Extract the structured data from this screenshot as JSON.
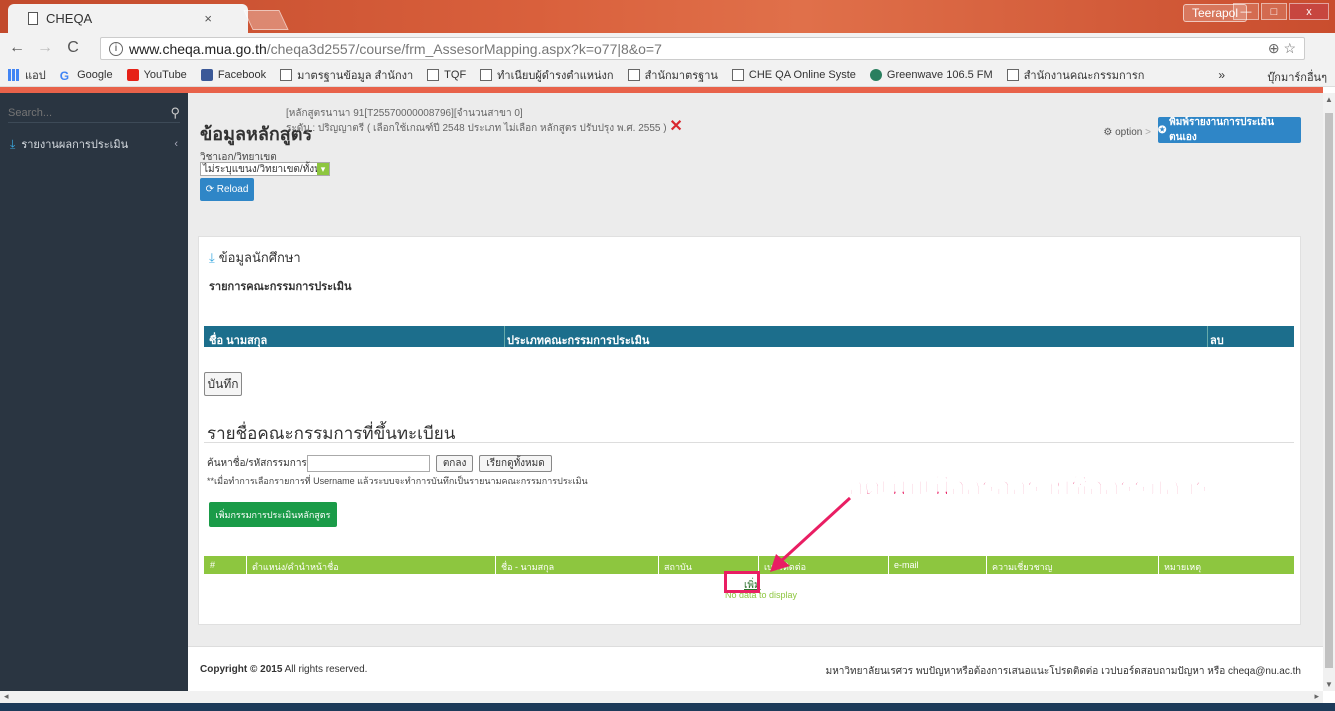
{
  "browser": {
    "tab_title": "CHEQA",
    "tab_close": "×",
    "user_badge": "Teerapol",
    "url_host": "www.cheqa.mua.go.th",
    "url_path": "/cheqa3d2557/course/frm_AssesorMapping.aspx?k=o77|8&o=7",
    "nav_back": "←",
    "nav_forward": "→",
    "nav_reload": "C",
    "zoom_star": "⊕ ☆",
    "win_min": "—",
    "win_max": "□",
    "win_close": "x"
  },
  "bookmarks": {
    "items": [
      "แอป",
      "Google",
      "YouTube",
      "Facebook",
      "มาตรฐานข้อมูล สำนักงา",
      "TQF",
      "ทำเนียบผู้ดำรงตำแหน่งก",
      "สำนักมาตรฐาน",
      "CHE QA Online Syste",
      "Greenwave 106.5 FM",
      "สำนักงานคณะกรรมการก"
    ],
    "more": "»",
    "other": "บุ๊กมาร์กอื่นๆ"
  },
  "sidebar": {
    "search_placeholder": "Search...",
    "item_label": "รายงานผลการประเมิน",
    "chevron": "‹"
  },
  "header": {
    "title": "ข้อมูลหลักสูตร",
    "meta_line1": "[หลักสูตรนานา 91[T25570000008796][จำนวนสาขา 0]",
    "meta_line2": "ระดับ : ปริญญาตรี ( เลือกใช้เกณฑ์ปี 2548 ประเภท ไม่เลือก หลักสูตร ปรับปรุง พ.ศ. 2555 )",
    "sub": "วิชาเอก/วิทยาเขต",
    "select_value": "ไม่ระบุแขนง/วิทยาเขต/ทั้งหม",
    "reload": "Reload",
    "option": "option",
    "option_sep": ">",
    "print_button": "พิมพ์รายงานการประเมินตนเอง"
  },
  "panel": {
    "title": "ข้อมูลนักศึกษา",
    "section1": "รายการคณะกรรมการประเมิน",
    "table1_headers": [
      "ชื่อ นามสกุล",
      "ประเภทคณะกรรมการประเมิน",
      "ลบ"
    ],
    "save": "บันทึก",
    "section2": "รายชื่อคณะกรรมการที่ขึ้นทะเบียน",
    "search_label": "ค้นหาชื่อ/รหัสกรรมการ",
    "ok_button": "ตกลง",
    "show_all_button": "เรียกดูทั้งหมด",
    "note": "**เมื่อทำการเลือกรายการที่ Username แล้วระบบจะทำการบันทึกเป็นรายนามคณะกรรมการประเมิน",
    "add_button": "เพิ่มกรรมการประเมินหลักสูตร",
    "table2_headers": [
      "#",
      "ตำแหน่ง/คำนำหน้าชื่อ",
      "ชื่อ - นามสกุล",
      "สถาบัน",
      "เบอร์ติดต่อ",
      "e-mail",
      "ความเชี่ยวชาญ",
      "หมายเหตุ"
    ],
    "add_link": "เพิ่ม",
    "no_data": "No data to display"
  },
  "annotation": {
    "callout": "กดเพิ่มเพื่อกรอกรายชื่อกรรมการ",
    "color": "#e91e63"
  },
  "footer": {
    "copyright_bold": "Copyright © 2015",
    "copyright_rest": " All rights reserved.",
    "right": "มหาวิทยาลัยนเรศวร พบปัญหาหรือต้องการเสนอแนะโปรดติดต่อ เวปบอร์ดสอบถามปัญหา หรือ cheqa@nu.ac.th"
  }
}
